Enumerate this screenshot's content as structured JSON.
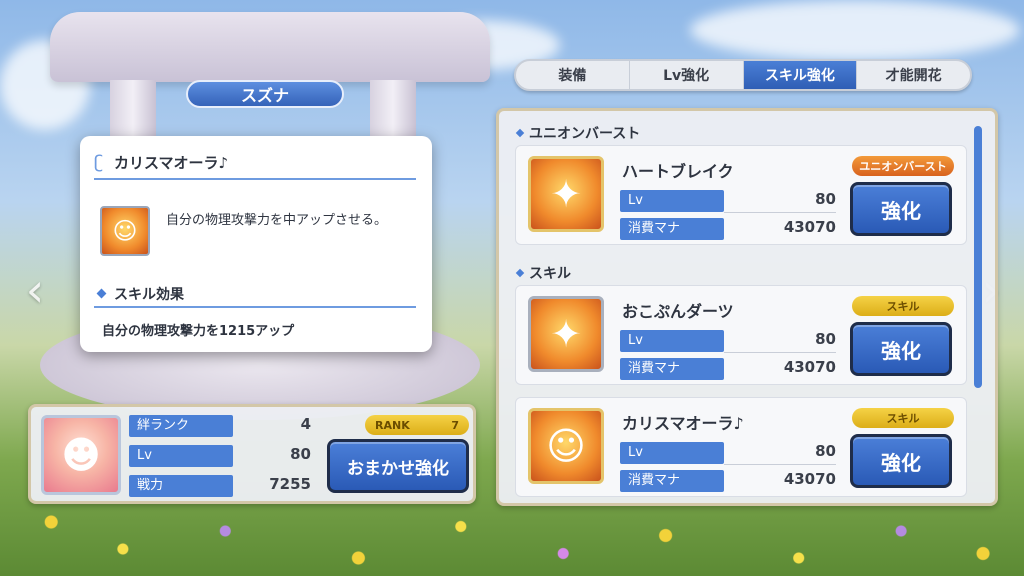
{
  "character": {
    "name": "スズナ",
    "rank_label": "絆ランク",
    "rank_value": "4",
    "rank_badge_label": "RANK",
    "rank_badge_value": "7",
    "lv_label": "Lv",
    "lv_value": "80",
    "power_label": "戦力",
    "power_value": "7255",
    "auto_enhance_label": "おまかせ強化"
  },
  "tabs": [
    {
      "label": "装備"
    },
    {
      "label": "Lv強化"
    },
    {
      "label": "スキル強化"
    },
    {
      "label": "才能開花"
    }
  ],
  "active_tab": "スキル強化",
  "sections": {
    "union_burst": "ユニオンバースト",
    "skill": "スキル"
  },
  "skills": [
    {
      "name": "ハートブレイク",
      "badge": "ユニオンバースト",
      "lv_label": "Lv",
      "lv": "80",
      "cost_label": "消費マナ",
      "cost": "43070",
      "button": "強化"
    },
    {
      "name": "おこぷんダーツ",
      "badge": "スキル",
      "lv_label": "Lv",
      "lv": "80",
      "cost_label": "消費マナ",
      "cost": "43070",
      "button": "強化"
    },
    {
      "name": "カリスマオーラ♪",
      "badge": "スキル",
      "lv_label": "Lv",
      "lv": "80",
      "cost_label": "消費マナ",
      "cost": "43070",
      "button": "強化"
    }
  ],
  "tooltip": {
    "title": "カリスマオーラ♪",
    "description": "自分の物理攻撃力を中アップさせる。",
    "effect_header": "スキル効果",
    "effect": "自分の物理攻撃力を1215アップ"
  },
  "icons": {
    "left_arrow": "chevron-left-icon",
    "right_arrow": "chevron-right-icon"
  },
  "colors": {
    "accent": "#4a7fd6",
    "button": "#2a5ab6",
    "badge_orange": "#d8621e",
    "badge_yellow": "#dcae18"
  }
}
